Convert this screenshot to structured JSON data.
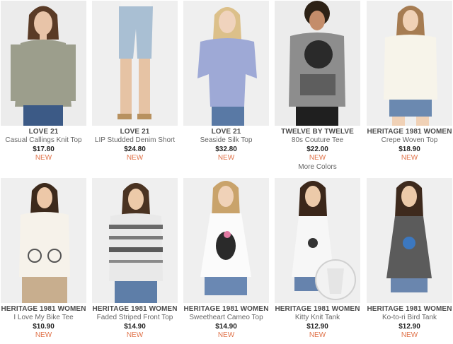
{
  "colors": {
    "new_badge": "#e0734a",
    "price": "#222222",
    "brand": "#4a4a4a"
  },
  "products": [
    {
      "brand": "LOVE 21",
      "name": "Casual Callings Knit Top",
      "price": "$17.80",
      "badge": "NEW",
      "more": ""
    },
    {
      "brand": "LOVE 21",
      "name": "LIP Studded Denim Short",
      "price": "$24.80",
      "badge": "NEW",
      "more": ""
    },
    {
      "brand": "LOVE 21",
      "name": "Seaside Silk Top",
      "price": "$32.80",
      "badge": "NEW",
      "more": ""
    },
    {
      "brand": "TWELVE BY TWELVE",
      "name": "80s Couture Tee",
      "price": "$22.00",
      "badge": "NEW",
      "more": "More Colors"
    },
    {
      "brand": "HERITAGE 1981 WOMEN",
      "name": "Crepe Woven Top",
      "price": "$18.90",
      "badge": "NEW",
      "more": ""
    },
    {
      "brand": "HERITAGE 1981 WOMEN",
      "name": "I Love My Bike Tee",
      "price": "$10.90",
      "badge": "NEW",
      "more": ""
    },
    {
      "brand": "HERITAGE 1981 WOMEN",
      "name": "Faded Striped Front Top",
      "price": "$14.90",
      "badge": "NEW",
      "more": ""
    },
    {
      "brand": "HERITAGE 1981 WOMEN",
      "name": "Sweetheart Cameo Top",
      "price": "$14.90",
      "badge": "NEW",
      "more": ""
    },
    {
      "brand": "HERITAGE 1981 WOMEN",
      "name": "Kitty Knit Tank",
      "price": "$12.90",
      "badge": "NEW",
      "more": ""
    },
    {
      "brand": "HERITAGE 1981 WOMEN",
      "name": "Ko-to-ri Bird Tank",
      "price": "$12.90",
      "badge": "NEW",
      "more": ""
    }
  ]
}
